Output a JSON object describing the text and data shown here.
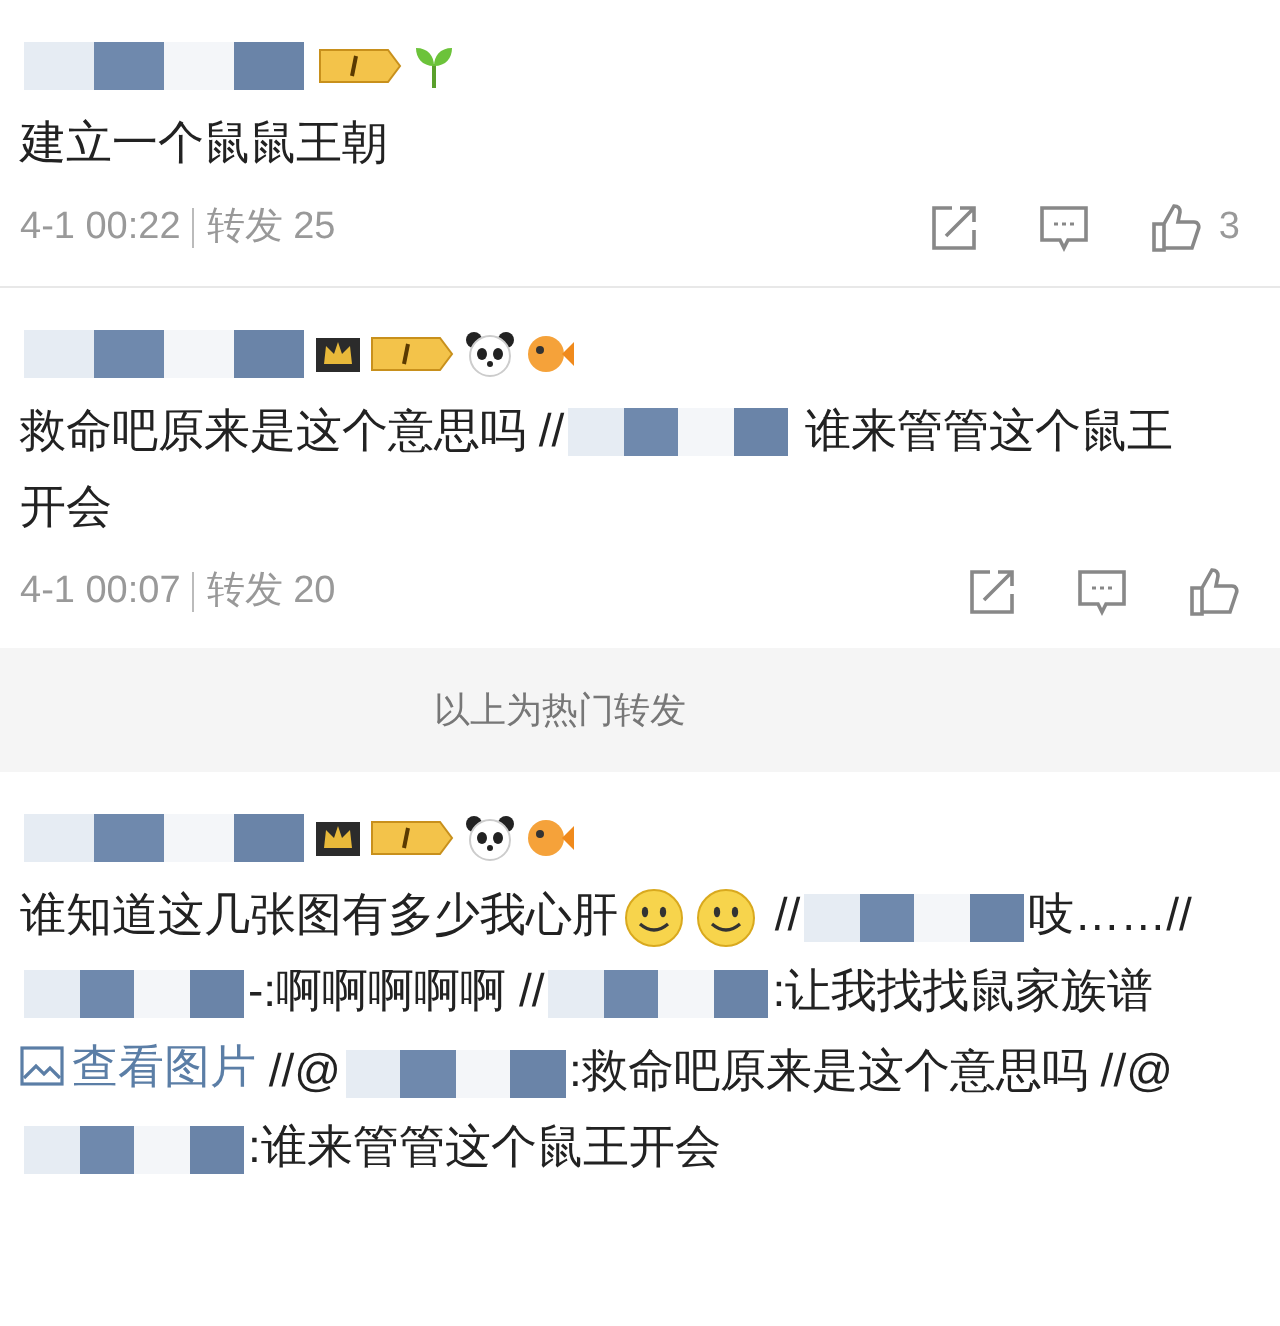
{
  "posts": [
    {
      "badges": [
        {
          "kind": "level"
        },
        {
          "kind": "sprout"
        }
      ],
      "content": [
        {
          "kind": "text",
          "text": "建立一个鼠鼠王朝"
        }
      ],
      "time": "4-1 00:22",
      "reposts": "转发 25",
      "likes": "3"
    },
    {
      "badges": [
        {
          "kind": "crown"
        },
        {
          "kind": "level"
        },
        {
          "kind": "panda"
        },
        {
          "kind": "fish"
        }
      ],
      "content": [
        {
          "kind": "text",
          "text": "救命吧原来是这个意思吗 //"
        },
        {
          "kind": "redacted"
        },
        {
          "kind": "text",
          "text": " 谁来管管这个鼠王开会"
        }
      ],
      "time": "4-1 00:07",
      "reposts": "转发 20"
    }
  ],
  "section_label": "以上为热门转发",
  "latest": [
    {
      "badges": [
        {
          "kind": "crown"
        },
        {
          "kind": "level"
        },
        {
          "kind": "panda"
        },
        {
          "kind": "fish"
        }
      ],
      "content": [
        {
          "kind": "text",
          "text": "谁知道这几张图有多少我心肝"
        },
        {
          "kind": "emoji"
        },
        {
          "kind": "emoji"
        },
        {
          "kind": "text",
          "text": " //"
        },
        {
          "kind": "redacted"
        },
        {
          "kind": "text",
          "text": "吱……//"
        },
        {
          "kind": "redacted"
        },
        {
          "kind": "text",
          "text": "-:啊啊啊啊啊 //"
        },
        {
          "kind": "redacted"
        },
        {
          "kind": "text",
          "text": ":让我找找鼠家族谱 "
        },
        {
          "kind": "link",
          "text": "查看图片"
        },
        {
          "kind": "text",
          "text": " //@"
        },
        {
          "kind": "redacted"
        },
        {
          "kind": "text",
          "text": ":救命吧原来是这个意思吗 //@"
        },
        {
          "kind": "redacted"
        },
        {
          "kind": "text",
          "text": ":谁来管管这个鼠王开会"
        }
      ]
    }
  ]
}
